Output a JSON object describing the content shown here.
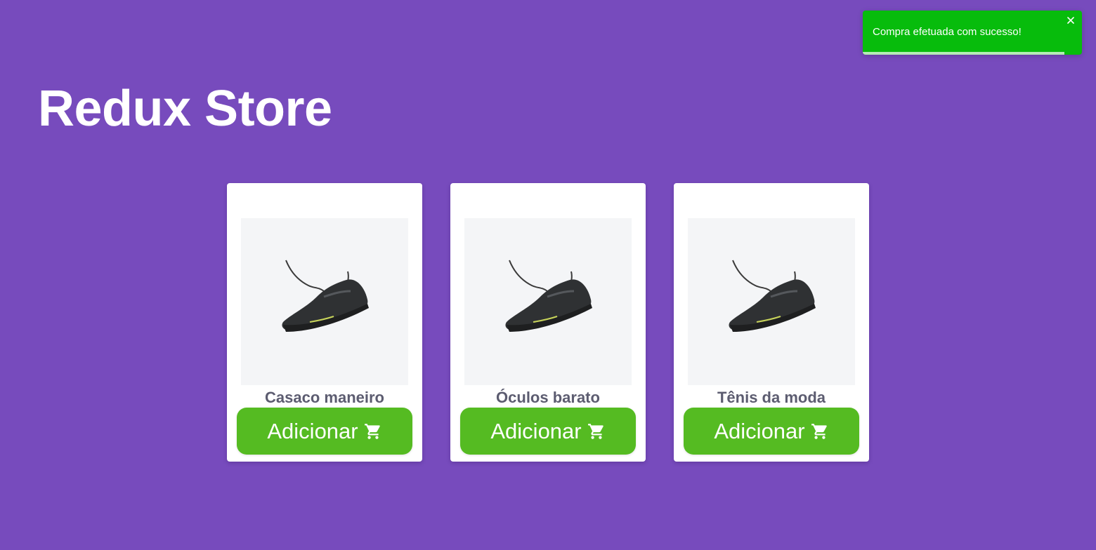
{
  "header": {
    "title": "Redux Store"
  },
  "products": [
    {
      "name": "Casaco maneiro",
      "button_label": "Adicionar",
      "image_icon": "sneaker-image"
    },
    {
      "name": "Óculos barato",
      "button_label": "Adicionar",
      "image_icon": "sneaker-image"
    },
    {
      "name": "Tênis da moda",
      "button_label": "Adicionar",
      "image_icon": "sneaker-image"
    }
  ],
  "toast": {
    "message": "Compra efetuada com sucesso!",
    "close_icon": "close-icon",
    "progress_remaining": 0.92
  },
  "colors": {
    "background": "#774bbd",
    "button": "#55bb22",
    "toast": "#07bc0c",
    "product_name": "#5c5c70"
  }
}
